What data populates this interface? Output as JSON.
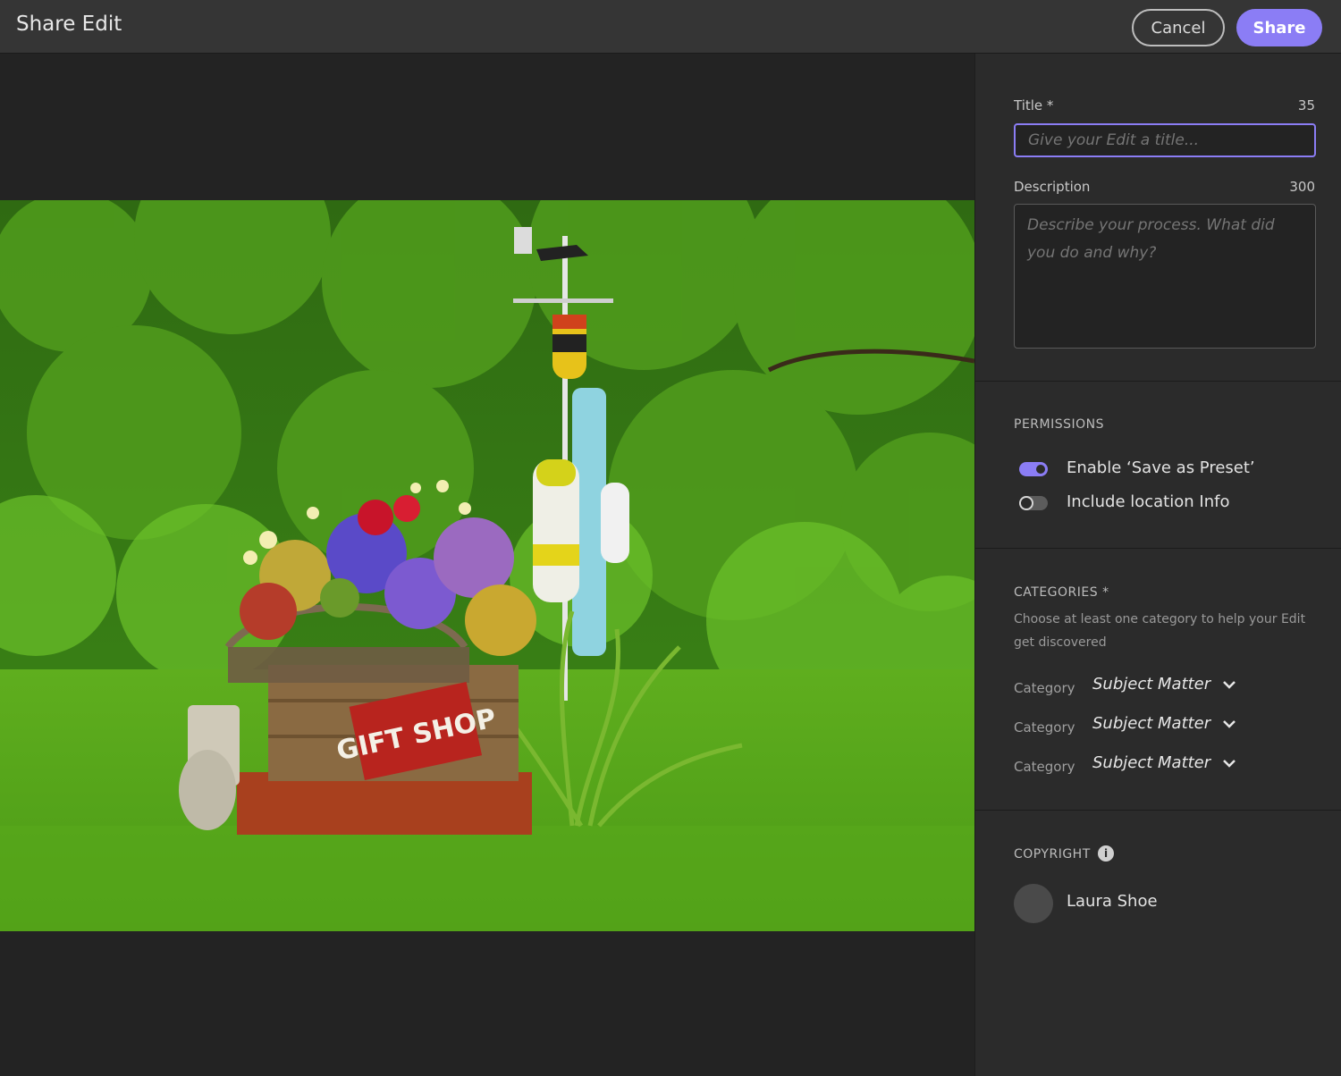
{
  "window": {
    "title": "Share Edit"
  },
  "toolbar": {
    "cancel_label": "Cancel",
    "share_label": "Share"
  },
  "form": {
    "title_label": "Title *",
    "title_count": "35",
    "title_placeholder": "Give your Edit a title...",
    "description_label": "Description",
    "description_count": "300",
    "description_placeholder": "Describe your process. What did you do and why?"
  },
  "permissions": {
    "heading": "PERMISSIONS",
    "items": [
      {
        "label": "Enable ‘Save as Preset’",
        "enabled": true
      },
      {
        "label": "Include location Info",
        "enabled": false
      }
    ]
  },
  "categories": {
    "heading": "CATEGORIES *",
    "helper": "Choose at least one category to help your Edit get discovered",
    "rows": [
      {
        "label": "Category",
        "value": "Subject Matter"
      },
      {
        "label": "Category",
        "value": "Subject Matter"
      },
      {
        "label": "Category",
        "value": "Subject Matter"
      }
    ]
  },
  "copyright": {
    "heading": "COPYRIGHT",
    "owner": "Laura Shoe"
  },
  "photo": {
    "sign_text": "GIFT SHOP"
  },
  "colors": {
    "accent": "#8b7df5",
    "panel_bg": "#2b2b2b",
    "titlebar_bg": "#353535"
  }
}
